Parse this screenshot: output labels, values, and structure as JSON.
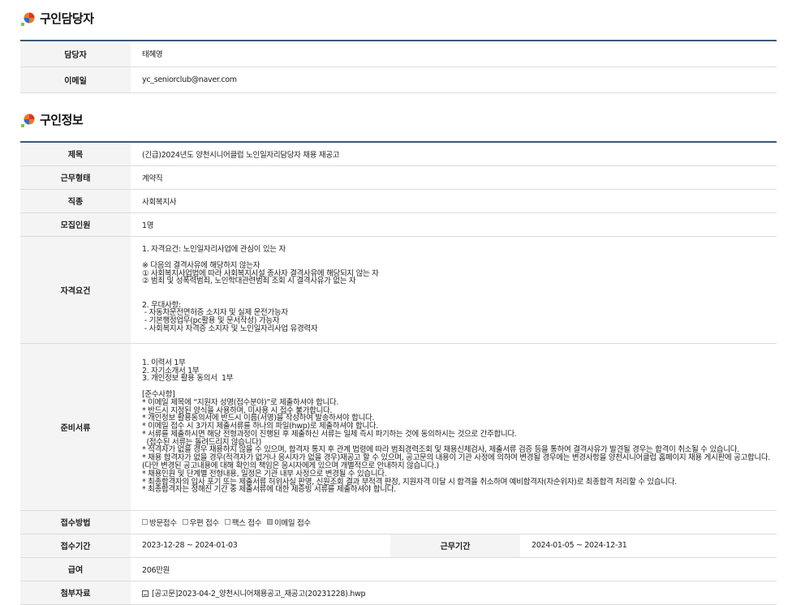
{
  "manager_section": {
    "title": "구인담당자",
    "rows": [
      {
        "label": "담당자",
        "value": "태혜영"
      },
      {
        "label": "이메일",
        "value": "yc_seniorclub@naver.com"
      }
    ]
  },
  "job_section": {
    "title": "구인정보",
    "subject": {
      "label": "제목",
      "value": "(긴급)2024년도 양천시니어클럽 노인일자리담당자 채용 재공고"
    },
    "work_type": {
      "label": "근무형태",
      "value": "계약직"
    },
    "job_category": {
      "label": "직종",
      "value": "사회복지사"
    },
    "headcount": {
      "label": "모집인원",
      "value": "1명"
    },
    "qualifications": {
      "label": "자격요건",
      "text": "1. 자격요건: 노인일자리사업에 관심이 있는 자\n\n※ 다음의 결격사유에 해당하지 않는자\n① 사회복지사업법에 따라 사회복지시설 종사자 결격사유에 해당되지 않는 자\n② 범죄 및 성폭력범죄, 노인학대관련범죄 조회 시 결격사유가 없는 자\n\n\n2. 우대사항:\n - 자동차운전면허증 소지자 및 실제 운전가능자\n - 기본행정업무(pc활용 및 문서작성) 가능자\n - 사회복지사 자격증 소지자 및 노인일자리사업 유경력자"
    },
    "documents": {
      "label": "준비서류",
      "text": "1. 이력서 1부\n2. 자기소개서 1부\n3. 개인정보 활용 동의서  1부\n\n[준수사항]\n* 이메일 제목에 “지원자 성명(접수분야)”로 제출하셔야 합니다.\n* 반드시 지정된 양식을 사용하며, 미사용 시 접수 불가합니다.\n* 개인정보 활용동의서에 반드시 이름(서명)을 작성하여 발송하셔야 합니다.\n* 이메일 접수 시 3가지 제출서류를 하나의 파일(hwp)로 제출하셔야 합니다.\n* 서류를 제출하시면 해당 전형과정이 진행된 후 제출하신 서류는 일체 즉시 파기하는 것에 동의하시는 것으로 간주합니다.\n  (접수된 서류는 돌려드리지 않습니다)\n* 적격자가 없을 경우 채용하지 않을 수 있으며, 합격자 통지 후 관계 법령에 따라 범죄경력조회 및 채용신체검사, 제출서류 검증 등을 통하여 결격사유가 발견될 경우는 합격이 취소될 수 있습니다.\n* 채용 합격자가 없을 경우(적격자가 없거나 응시자가 없을 경우)재공고 할 수 있으며, 공고문의 내용이 기관 사정에 의하여 변경될 경우에는 변경사항을 양천시니어클럽 홈페이지 채용 게시판에 공고합니다.(다만 변경된 공고내용에 대해 확인의 책임은 응시자에게 있으며 개별적으로 안내하지 않습니다.)\n* 채용인원 및 단계별 전형내용, 일정은 기관 내부 사정으로 변경될 수 있습니다.\n* 최종합격자의 입사 포기 또는 제출서류 허위사실 판명, 신원조회 결과 부적격 판정, 지원자격 미달 시 합격을 취소하며 예비합격자(차순위자)로 최종합격 처리할 수 있습니다.\n* 최종합격자는 정해진 기간 중 제출서류에 대한 제증빙 서류를 제출하셔야 합니다."
    },
    "method": {
      "label": "접수방법",
      "options": [
        {
          "label": "방문접수",
          "checked": false
        },
        {
          "label": "우편 접수",
          "checked": false
        },
        {
          "label": "팩스 접수",
          "checked": false
        },
        {
          "label": "이메일 접수",
          "checked": true
        }
      ]
    },
    "period": {
      "label": "접수기간",
      "value": "2023-12-28 ~ 2024-01-03",
      "work_label": "근무기간",
      "work_value": "2024-01-05 ~ 2024-12-31"
    },
    "salary": {
      "label": "급여",
      "value": "206만원"
    },
    "attachment": {
      "label": "첨부자료",
      "value": "[공고문]2023-04-2_양천시니어채용공고_재공고(20231228).hwp"
    }
  }
}
